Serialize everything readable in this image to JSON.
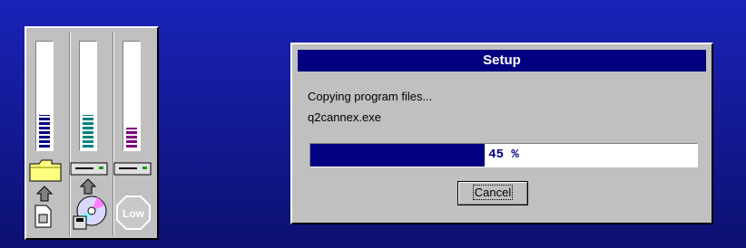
{
  "meters": [
    {
      "name": "source",
      "color": "#000080",
      "level": 0.3
    },
    {
      "name": "destination",
      "color": "#008080",
      "level": 0.3
    },
    {
      "name": "memory",
      "color": "#800080",
      "level": 0.18
    }
  ],
  "icons": {
    "folder": "folder-icon",
    "drive": "drive-icon",
    "up_arrow": "up-arrow-icon",
    "document": "document-icon",
    "cdrom": "cdrom-icon",
    "low_sign_text": "Low"
  },
  "dialog": {
    "title": "Setup",
    "status": "Copying program files...",
    "file": "q2cannex.exe",
    "progress_value": 45,
    "progress_text": "45 %",
    "cancel_label": "Cancel"
  }
}
